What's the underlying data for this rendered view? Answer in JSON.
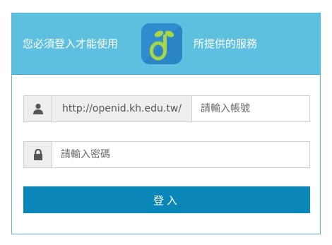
{
  "header": {
    "left_text": "您必須登入才能使用",
    "right_text": "所提供的服務",
    "logo_icon": "openid-sprout-logo-icon",
    "background_color": "#5ec0df"
  },
  "username": {
    "icon": "user-icon",
    "prefix": "http://openid.kh.edu.tw/",
    "placeholder": "請輸入帳號",
    "value": ""
  },
  "password": {
    "icon": "lock-icon",
    "placeholder": "請輸入密碼",
    "value": ""
  },
  "submit": {
    "label": "登入",
    "color": "#0a86b8"
  }
}
